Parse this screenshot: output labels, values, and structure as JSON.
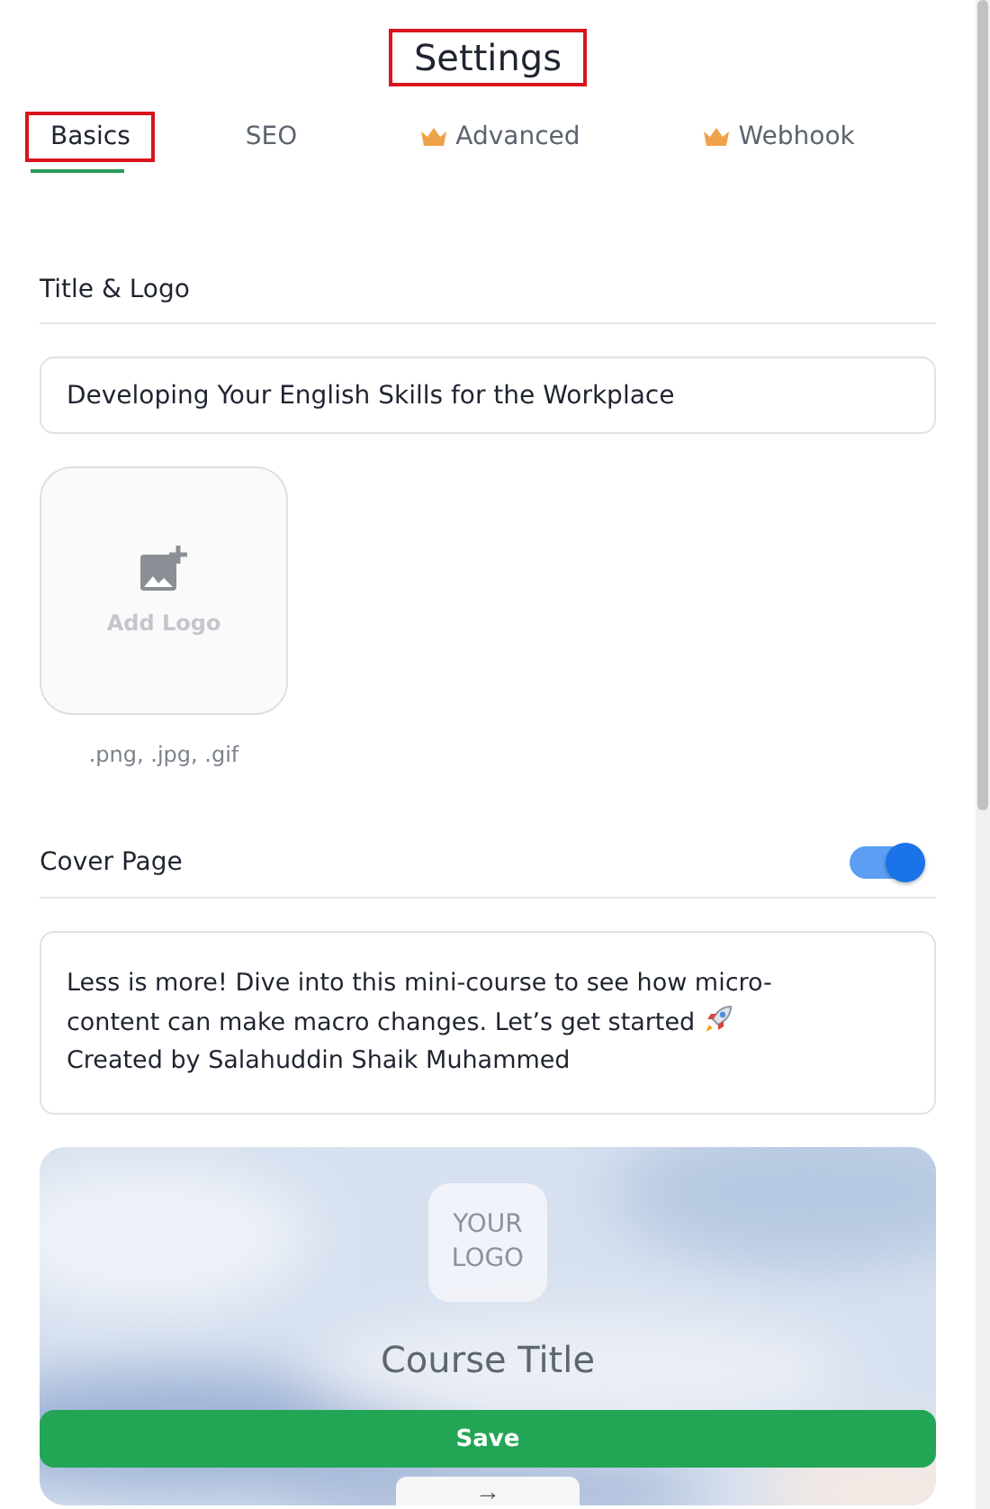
{
  "title": "Settings",
  "tabs": [
    {
      "label": "Basics",
      "selected": true,
      "premium": false,
      "highlighted": true
    },
    {
      "label": "SEO",
      "selected": false,
      "premium": false,
      "highlighted": false
    },
    {
      "label": "Advanced",
      "selected": false,
      "premium": true,
      "highlighted": false
    },
    {
      "label": "Webhook",
      "selected": false,
      "premium": true,
      "highlighted": false
    }
  ],
  "title_highlighted": true,
  "title_logo": {
    "heading": "Title & Logo",
    "title_value": "Developing Your English Skills for the Workplace",
    "logo_label": "Add Logo",
    "formats": ".png, .jpg, .gif"
  },
  "cover": {
    "heading": "Cover Page",
    "on": true,
    "description": "Less is more! Dive into this mini-course to see how micro-content can make macro changes. Let’s get started",
    "credit": "Created by Salahuddin Shaik Muhammed",
    "preview": {
      "logo_text": "YOUR LOGO",
      "course_title": "Course Title",
      "next_label": "→"
    }
  },
  "save_label": "Save"
}
